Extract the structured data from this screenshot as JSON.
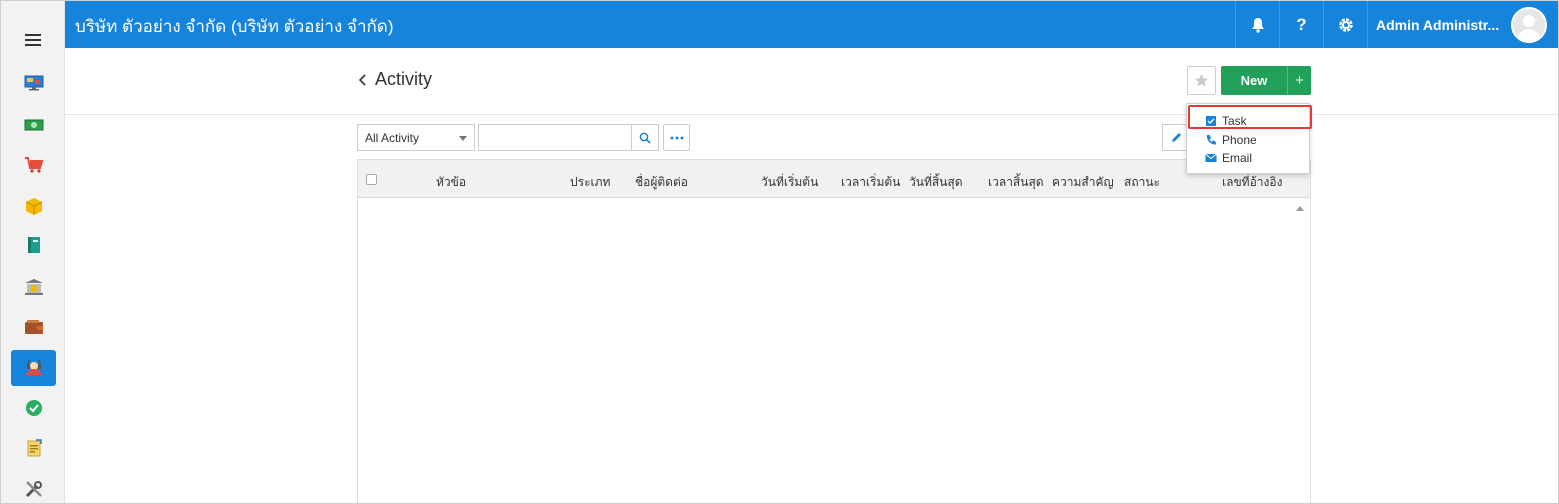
{
  "topbar": {
    "company": "บริษัท ตัวอย่าง จำกัด (บริษัท ตัวอย่าง จำกัด)",
    "user_name": "Admin Administr...",
    "bell_glyph": "🔔",
    "help_glyph": "?",
    "gear_glyph": "⚙"
  },
  "header": {
    "title": "Activity",
    "new_label": "New",
    "plus_label": "+"
  },
  "toolbar": {
    "filter_value": "All Activity",
    "search_value": "",
    "search_placeholder": ""
  },
  "table": {
    "columns": [
      "หัวข้อ",
      "ประเภท",
      "ชื่อผู้ติดต่อ",
      "วันที่เริ่มต้น",
      "เวลาเริ่มต้น",
      "วันที่สิ้นสุด",
      "เวลาสิ้นสุด",
      "ความสำคัญ",
      "สถานะ",
      "เลขที่อ้างอิง"
    ]
  },
  "new_menu": {
    "items": [
      {
        "label": "Task",
        "icon": "task-icon"
      },
      {
        "label": "Phone",
        "icon": "phone-icon"
      },
      {
        "label": "Email",
        "icon": "email-icon"
      }
    ]
  },
  "sidebar": {
    "items": [
      {
        "icon": "monitor-icon"
      },
      {
        "icon": "cash-icon"
      },
      {
        "icon": "cart-icon"
      },
      {
        "icon": "box-icon"
      },
      {
        "icon": "book-icon"
      },
      {
        "icon": "bank-icon"
      },
      {
        "icon": "wallet-icon"
      },
      {
        "icon": "crm-icon",
        "active": true
      },
      {
        "icon": "check-circle-icon"
      },
      {
        "icon": "report-icon"
      },
      {
        "icon": "tools-icon"
      }
    ]
  },
  "colors": {
    "primary": "#1784db",
    "success": "#21a05a",
    "highlight": "#e53935"
  }
}
